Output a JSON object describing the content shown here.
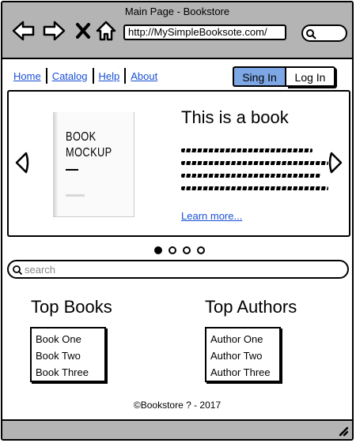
{
  "window": {
    "title": "Main Page - Bookstore"
  },
  "browser": {
    "url": "http://MySimpleBooksote.com/",
    "icons": [
      "back-arrow-icon",
      "forward-arrow-icon",
      "close-icon",
      "home-icon",
      "search-icon"
    ]
  },
  "menu": {
    "items": [
      {
        "label": "Home"
      },
      {
        "label": "Catalog"
      },
      {
        "label": "Help"
      },
      {
        "label": "About"
      }
    ]
  },
  "auth": {
    "signin_label": "Sing In",
    "login_label": "Log In",
    "accent": "#7ea7e6"
  },
  "carousel": {
    "cover_title": "BOOK\nMOCKUP",
    "book_title": "This is a book",
    "link_label": "Learn more...",
    "dots": 4,
    "active_dot": 0
  },
  "search": {
    "placeholder": "search"
  },
  "top_books": {
    "heading": "Top Books",
    "items": [
      "Book One",
      "Book Two",
      "Book Three"
    ]
  },
  "top_authors": {
    "heading": "Top Authors",
    "items": [
      "Author One",
      "Author Two",
      "Author Three"
    ]
  },
  "footer": {
    "text": "©Bookstore ? - 2017"
  },
  "colors": {
    "chrome": "#b4b4b4",
    "link": "#1a4fd6"
  }
}
